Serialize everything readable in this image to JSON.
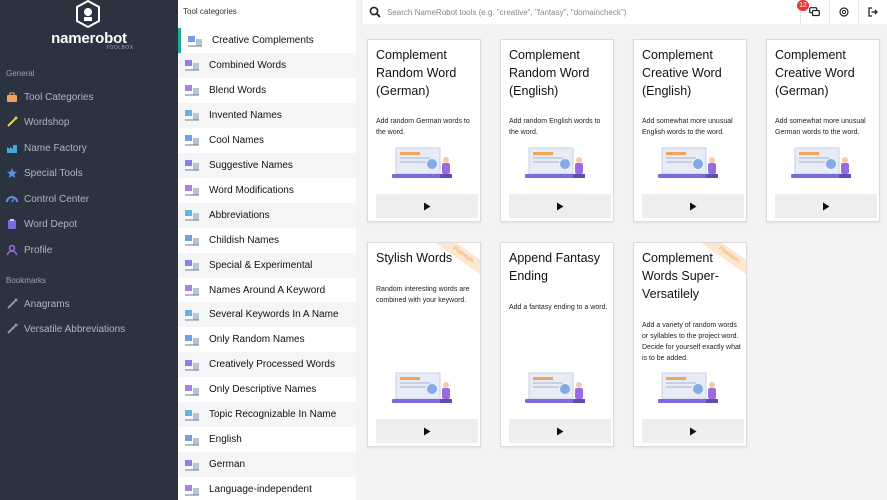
{
  "brand": {
    "name": "namerobot",
    "sub": "TOOLBOX"
  },
  "sidebar": {
    "general_label": "General",
    "bookmarks_label": "Bookmarks",
    "items": [
      {
        "label": "Tool Categories",
        "icon": "toolbox-icon",
        "color": "#f0a35a"
      },
      {
        "label": "Wordshop",
        "icon": "wand-icon",
        "color": "#e8d34a"
      },
      {
        "label": "Name Factory",
        "icon": "factory-icon",
        "color": "#4aa8d8"
      },
      {
        "label": "Special Tools",
        "icon": "star-icon",
        "color": "#5b8fe0"
      },
      {
        "label": "Control Center",
        "icon": "dashboard-icon",
        "color": "#5b8fe0"
      },
      {
        "label": "Word Depot",
        "icon": "clipboard-icon",
        "color": "#7a6be0"
      },
      {
        "label": "Profile",
        "icon": "user-icon",
        "color": "#9a6be0"
      }
    ],
    "bookmarks": [
      {
        "label": "Anagrams",
        "icon": "anagram-icon"
      },
      {
        "label": "Versatile Abbreviations",
        "icon": "abbreviation-icon"
      }
    ]
  },
  "categories": {
    "title": "Tool categories",
    "items": [
      "Creative Complements",
      "Combined Words",
      "Blend Words",
      "Invented Names",
      "Cool Names",
      "Suggestive Names",
      "Word Modifications",
      "Abbreviations",
      "Childish Names",
      "Special & Experimental",
      "Names Around A Keyword",
      "Several Keywords In A Name",
      "Only Random Names",
      "Creatively Processed Words",
      "Only Descriptive Names",
      "Topic Recognizable In Name",
      "English",
      "German",
      "Language-independent"
    ]
  },
  "search": {
    "placeholder": "Search NameRobot tools (e.g. \"creative\", \"fantasy\", \"domaincheck\")"
  },
  "topbar": {
    "notifications_count": "12"
  },
  "cards": [
    {
      "title": "Complement Random Word (German)",
      "desc": "Add random German words to the word.",
      "premium": false
    },
    {
      "title": "Complement Random Word (English)",
      "desc": "Add random English words to the word.",
      "premium": false
    },
    {
      "title": "Complement Creative Word (English)",
      "desc": "Add somewhat more unusual English words to the word.",
      "premium": false
    },
    {
      "title": "Complement Creative Word (German)",
      "desc": "Add somewhat more unusual German words to the word.",
      "premium": false
    },
    {
      "title": "Stylish Words",
      "desc": "Random interesting words are combined with your keyword.",
      "premium": true
    },
    {
      "title": "Append Fantasy Ending",
      "desc": "Add a fantasy ending to a word.",
      "premium": false
    },
    {
      "title": "Complement Words Super-Versatilely",
      "desc": "Add a variety of random words or syllables to the project word. Decide for yourself exactly what is to be added.",
      "premium": true
    }
  ],
  "premium_label": "Premium"
}
